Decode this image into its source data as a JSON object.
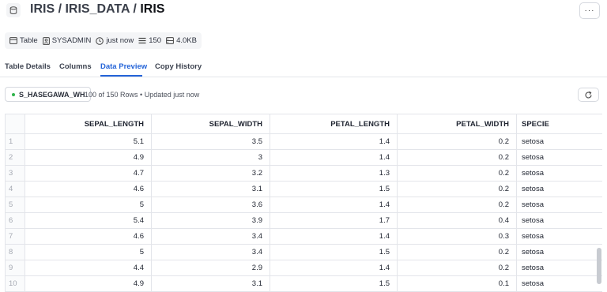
{
  "header": {
    "breadcrumb": [
      "IRIS",
      "IRIS_DATA",
      "IRIS"
    ],
    "separator": "/",
    "more_label": "···",
    "icon": "database-icon"
  },
  "meta": {
    "type_label": "Table",
    "owner": "SYSADMIN",
    "updated": "just now",
    "rows": "150",
    "size": "4.0KB"
  },
  "tabs": [
    "Table Details",
    "Columns",
    "Data Preview",
    "Copy History"
  ],
  "active_tab": "Data Preview",
  "preview": {
    "warehouse": "S_HASEGAWA_WH",
    "rows_info": "100 of 150 Rows • Updated just now"
  },
  "table": {
    "columns": [
      "SEPAL_LENGTH",
      "SEPAL_WIDTH",
      "PETAL_LENGTH",
      "PETAL_WIDTH",
      "SPECIE"
    ],
    "rows": [
      [
        "1",
        "5.1",
        "3.5",
        "1.4",
        "0.2",
        "setosa"
      ],
      [
        "2",
        "4.9",
        "3",
        "1.4",
        "0.2",
        "setosa"
      ],
      [
        "3",
        "4.7",
        "3.2",
        "1.3",
        "0.2",
        "setosa"
      ],
      [
        "4",
        "4.6",
        "3.1",
        "1.5",
        "0.2",
        "setosa"
      ],
      [
        "5",
        "5",
        "3.6",
        "1.4",
        "0.2",
        "setosa"
      ],
      [
        "6",
        "5.4",
        "3.9",
        "1.7",
        "0.4",
        "setosa"
      ],
      [
        "7",
        "4.6",
        "3.4",
        "1.4",
        "0.3",
        "setosa"
      ],
      [
        "8",
        "5",
        "3.4",
        "1.5",
        "0.2",
        "setosa"
      ],
      [
        "9",
        "4.4",
        "2.9",
        "1.4",
        "0.2",
        "setosa"
      ],
      [
        "10",
        "4.9",
        "3.1",
        "1.5",
        "0.1",
        "setosa"
      ]
    ]
  },
  "colors": {
    "accent": "#2464d8",
    "status_dot": "#2fb34a"
  }
}
